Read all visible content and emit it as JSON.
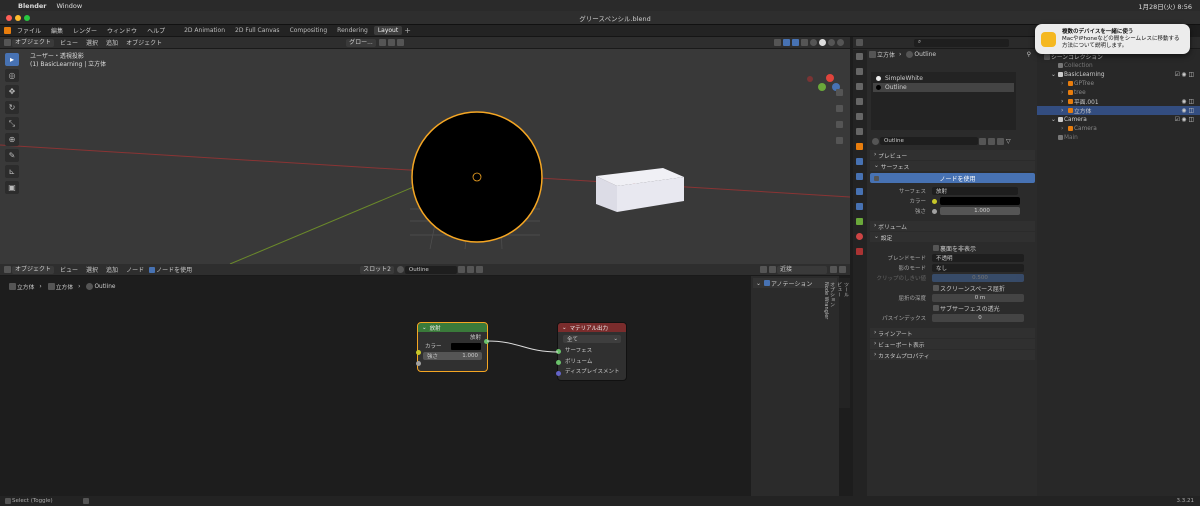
{
  "macbar": {
    "apple": "",
    "app": "Blender",
    "menu": "Window",
    "clock": "1月28日(火) 8:56"
  },
  "window": {
    "title": "グリースペンシル.blend"
  },
  "topmenu": [
    "ファイル",
    "編集",
    "レンダー",
    "ウィンドウ",
    "ヘルプ"
  ],
  "workspaces": [
    "2D Animation",
    "2D Full Canvas",
    "Compositing",
    "Rendering",
    "Layout"
  ],
  "viewport": {
    "mode": "オブジェクト",
    "menus": [
      "ビュー",
      "選択",
      "追加",
      "オブジェクト"
    ],
    "info_line1": "ユーザー・透視投影",
    "info_line2": "(1) BasicLearning | 立方体",
    "transform_label": "グロー..."
  },
  "node_editor": {
    "mode": "オブジェクト",
    "menus": [
      "ビュー",
      "選択",
      "追加",
      "ノード"
    ],
    "use_nodes": "ノードを使用",
    "slot": "スロット2",
    "material": "Outline",
    "breadcrumb": [
      "立方体",
      "立方体",
      "Outline"
    ],
    "sidebar_mode": "近接",
    "annotation": "アノテーション",
    "vtabs": [
      "ツール",
      "ビュー",
      "オプション",
      "Node Wrangler"
    ]
  },
  "node_emission": {
    "title": "放射",
    "output": "放射",
    "color_label": "カラー",
    "strength_label": "強さ",
    "strength_value": "1.000",
    "header_color": "#3a7a3a"
  },
  "node_output": {
    "title": "マテリアル出力",
    "target": "全て",
    "inputs": [
      "サーフェス",
      "ボリューム",
      "ディスプレイスメント"
    ],
    "header_color": "#7a2c2c"
  },
  "properties": {
    "object": "立方体",
    "material": "Outline",
    "slots": [
      "SimpleWhite",
      "Outline"
    ],
    "mat_field": "Outline",
    "sections": {
      "preview": "プレビュー",
      "surface": "サーフェス",
      "volume": "ボリューム",
      "settings": "設定",
      "lineart": "ラインアート",
      "viewport": "ビューポート表示",
      "custom": "カスタムプロパティ"
    },
    "use_nodes_btn": "ノードを使用",
    "surface_label": "サーフェス",
    "surface_value": "放射",
    "color_label": "カラー",
    "strength_label": "強さ",
    "strength_value": "1.000",
    "backface": "裏面を非表示",
    "blend_label": "ブレンドモード",
    "blend_value": "不透明",
    "shadow_label": "影のモード",
    "shadow_value": "なし",
    "clip_label": "クリップのしきい値",
    "clip_value": "0.500",
    "ssr": "スクリーンスペース屈折",
    "refr_label": "屈折の深度",
    "refr_value": "0 m",
    "sss": "サブサーフェスの透光",
    "pass_label": "パスインデックス",
    "pass_value": "0"
  },
  "outliner": {
    "scene_collection": "シーンコレクション",
    "items": [
      {
        "label": "Collection",
        "indent": 1,
        "dim": true
      },
      {
        "label": "BasicLearning",
        "indent": 1,
        "dim": false
      },
      {
        "label": "GPTree",
        "indent": 2,
        "dim": true
      },
      {
        "label": "tree",
        "indent": 2,
        "dim": true
      },
      {
        "label": "平面.001",
        "indent": 2,
        "dim": false
      },
      {
        "label": "立方体",
        "indent": 2,
        "dim": false,
        "selected": true
      },
      {
        "label": "Camera",
        "indent": 1,
        "dim": false
      },
      {
        "label": "Camera",
        "indent": 2,
        "dim": true
      },
      {
        "label": "Main",
        "indent": 1,
        "dim": true
      }
    ]
  },
  "notification": {
    "line1": "複数のデバイスを一緒に使う",
    "line2": "MacやiPhoneなどの間をシームレスに移動する",
    "line3": "方法について説明します。"
  },
  "status": {
    "left": "Select (Toggle)",
    "version": "3.3.21"
  },
  "colors": {
    "accent": "#4772b3",
    "selection_orange": "#f5a623"
  }
}
